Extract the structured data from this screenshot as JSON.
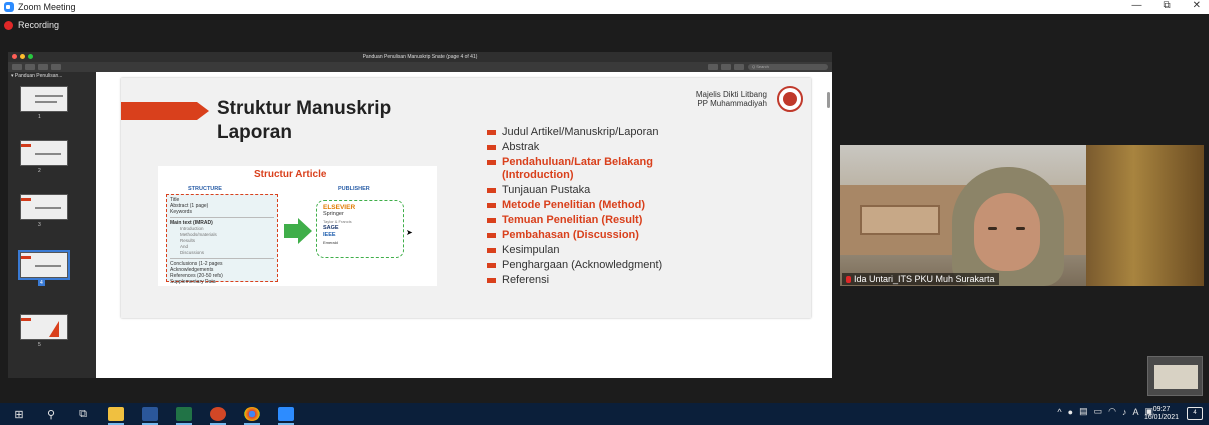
{
  "window": {
    "title": "Zoom Meeting",
    "controls": [
      "—",
      "⧉",
      "✕"
    ]
  },
  "recording": {
    "label": "Recording"
  },
  "viewer": {
    "title": "Panduan Penulisan Manuskrip Snate (page 4 of 41)",
    "sidebar_header": "▾ Panduan Penulisan...",
    "search_placeholder": "Q Search",
    "thumb_numbers": [
      "1",
      "2",
      "3",
      "4",
      "5"
    ]
  },
  "slide": {
    "title_line1": "Struktur Manuskrip",
    "title_line2": "Laporan",
    "org_line1": "Majelis Dikti Litbang",
    "org_line2": "PP Muhammadiyah",
    "bullets": [
      {
        "text": "Judul Artikel/Manuskrip/Laporan",
        "emphasis": false
      },
      {
        "text": "Abstrak",
        "emphasis": false
      },
      {
        "text": "Pendahuluan/Latar Belakang (Introduction)",
        "emphasis": true
      },
      {
        "text": "Tunjauan Pustaka",
        "emphasis": false
      },
      {
        "text": "Metode Penelitian (Method)",
        "emphasis": true
      },
      {
        "text": "Temuan Penelitian (Result)",
        "emphasis": true
      },
      {
        "text": "Pembahasan (Discussion)",
        "emphasis": true
      },
      {
        "text": "Kesimpulan",
        "emphasis": false
      },
      {
        "text": "Penghargaan (Acknowledgment)",
        "emphasis": false
      },
      {
        "text": "Referensi",
        "emphasis": false
      }
    ],
    "diagram": {
      "title": "Structur Article",
      "col_structure": "STRUCTURE",
      "col_publisher": "PUBLISHER",
      "structure_sections": [
        [
          "Title",
          "Abstract (1 page)",
          "Keywords"
        ],
        [
          "Main text (IMRAD)",
          "Introduction",
          "Methods/materials",
          "Results",
          "And",
          "Discussions"
        ],
        [
          "Conclusions (1-2 pages",
          "Acknowledgements",
          "References (20-50 refs)",
          "Supplementary Data"
        ]
      ],
      "publishers": [
        "ELSEVIER",
        "Springer",
        "Taylor & Francis",
        "SAGE",
        "IEEE",
        "Emerald"
      ]
    }
  },
  "participant": {
    "name": "Ida Untari_ITS PKU Muh Surakarta"
  },
  "taskbar": {
    "clock_time": "09:27",
    "clock_date": "16/01/2021",
    "notification_count": "4",
    "input_lang": "A"
  }
}
